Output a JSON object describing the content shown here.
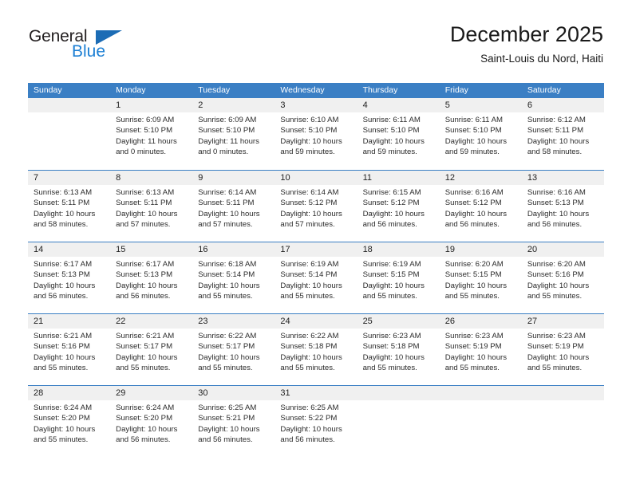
{
  "brand": {
    "name_part1": "General",
    "name_part2": "Blue",
    "triangle_icon": "triangle-icon",
    "accent_color": "#1c7fd4"
  },
  "header": {
    "title": "December 2025",
    "subtitle": "Saint-Louis du Nord, Haiti"
  },
  "calendar": {
    "header_bg": "#3b7fc4",
    "daynum_bg": "#f0f0f0",
    "weekdays": [
      "Sunday",
      "Monday",
      "Tuesday",
      "Wednesday",
      "Thursday",
      "Friday",
      "Saturday"
    ],
    "weeks": [
      [
        {
          "day": "",
          "sunrise": "",
          "sunset": "",
          "daylight_line1": "",
          "daylight_line2": "",
          "empty": true
        },
        {
          "day": "1",
          "sunrise": "Sunrise: 6:09 AM",
          "sunset": "Sunset: 5:10 PM",
          "daylight_line1": "Daylight: 11 hours",
          "daylight_line2": "and 0 minutes."
        },
        {
          "day": "2",
          "sunrise": "Sunrise: 6:09 AM",
          "sunset": "Sunset: 5:10 PM",
          "daylight_line1": "Daylight: 11 hours",
          "daylight_line2": "and 0 minutes."
        },
        {
          "day": "3",
          "sunrise": "Sunrise: 6:10 AM",
          "sunset": "Sunset: 5:10 PM",
          "daylight_line1": "Daylight: 10 hours",
          "daylight_line2": "and 59 minutes."
        },
        {
          "day": "4",
          "sunrise": "Sunrise: 6:11 AM",
          "sunset": "Sunset: 5:10 PM",
          "daylight_line1": "Daylight: 10 hours",
          "daylight_line2": "and 59 minutes."
        },
        {
          "day": "5",
          "sunrise": "Sunrise: 6:11 AM",
          "sunset": "Sunset: 5:10 PM",
          "daylight_line1": "Daylight: 10 hours",
          "daylight_line2": "and 59 minutes."
        },
        {
          "day": "6",
          "sunrise": "Sunrise: 6:12 AM",
          "sunset": "Sunset: 5:11 PM",
          "daylight_line1": "Daylight: 10 hours",
          "daylight_line2": "and 58 minutes."
        }
      ],
      [
        {
          "day": "7",
          "sunrise": "Sunrise: 6:13 AM",
          "sunset": "Sunset: 5:11 PM",
          "daylight_line1": "Daylight: 10 hours",
          "daylight_line2": "and 58 minutes."
        },
        {
          "day": "8",
          "sunrise": "Sunrise: 6:13 AM",
          "sunset": "Sunset: 5:11 PM",
          "daylight_line1": "Daylight: 10 hours",
          "daylight_line2": "and 57 minutes."
        },
        {
          "day": "9",
          "sunrise": "Sunrise: 6:14 AM",
          "sunset": "Sunset: 5:11 PM",
          "daylight_line1": "Daylight: 10 hours",
          "daylight_line2": "and 57 minutes."
        },
        {
          "day": "10",
          "sunrise": "Sunrise: 6:14 AM",
          "sunset": "Sunset: 5:12 PM",
          "daylight_line1": "Daylight: 10 hours",
          "daylight_line2": "and 57 minutes."
        },
        {
          "day": "11",
          "sunrise": "Sunrise: 6:15 AM",
          "sunset": "Sunset: 5:12 PM",
          "daylight_line1": "Daylight: 10 hours",
          "daylight_line2": "and 56 minutes."
        },
        {
          "day": "12",
          "sunrise": "Sunrise: 6:16 AM",
          "sunset": "Sunset: 5:12 PM",
          "daylight_line1": "Daylight: 10 hours",
          "daylight_line2": "and 56 minutes."
        },
        {
          "day": "13",
          "sunrise": "Sunrise: 6:16 AM",
          "sunset": "Sunset: 5:13 PM",
          "daylight_line1": "Daylight: 10 hours",
          "daylight_line2": "and 56 minutes."
        }
      ],
      [
        {
          "day": "14",
          "sunrise": "Sunrise: 6:17 AM",
          "sunset": "Sunset: 5:13 PM",
          "daylight_line1": "Daylight: 10 hours",
          "daylight_line2": "and 56 minutes."
        },
        {
          "day": "15",
          "sunrise": "Sunrise: 6:17 AM",
          "sunset": "Sunset: 5:13 PM",
          "daylight_line1": "Daylight: 10 hours",
          "daylight_line2": "and 56 minutes."
        },
        {
          "day": "16",
          "sunrise": "Sunrise: 6:18 AM",
          "sunset": "Sunset: 5:14 PM",
          "daylight_line1": "Daylight: 10 hours",
          "daylight_line2": "and 55 minutes."
        },
        {
          "day": "17",
          "sunrise": "Sunrise: 6:19 AM",
          "sunset": "Sunset: 5:14 PM",
          "daylight_line1": "Daylight: 10 hours",
          "daylight_line2": "and 55 minutes."
        },
        {
          "day": "18",
          "sunrise": "Sunrise: 6:19 AM",
          "sunset": "Sunset: 5:15 PM",
          "daylight_line1": "Daylight: 10 hours",
          "daylight_line2": "and 55 minutes."
        },
        {
          "day": "19",
          "sunrise": "Sunrise: 6:20 AM",
          "sunset": "Sunset: 5:15 PM",
          "daylight_line1": "Daylight: 10 hours",
          "daylight_line2": "and 55 minutes."
        },
        {
          "day": "20",
          "sunrise": "Sunrise: 6:20 AM",
          "sunset": "Sunset: 5:16 PM",
          "daylight_line1": "Daylight: 10 hours",
          "daylight_line2": "and 55 minutes."
        }
      ],
      [
        {
          "day": "21",
          "sunrise": "Sunrise: 6:21 AM",
          "sunset": "Sunset: 5:16 PM",
          "daylight_line1": "Daylight: 10 hours",
          "daylight_line2": "and 55 minutes."
        },
        {
          "day": "22",
          "sunrise": "Sunrise: 6:21 AM",
          "sunset": "Sunset: 5:17 PM",
          "daylight_line1": "Daylight: 10 hours",
          "daylight_line2": "and 55 minutes."
        },
        {
          "day": "23",
          "sunrise": "Sunrise: 6:22 AM",
          "sunset": "Sunset: 5:17 PM",
          "daylight_line1": "Daylight: 10 hours",
          "daylight_line2": "and 55 minutes."
        },
        {
          "day": "24",
          "sunrise": "Sunrise: 6:22 AM",
          "sunset": "Sunset: 5:18 PM",
          "daylight_line1": "Daylight: 10 hours",
          "daylight_line2": "and 55 minutes."
        },
        {
          "day": "25",
          "sunrise": "Sunrise: 6:23 AM",
          "sunset": "Sunset: 5:18 PM",
          "daylight_line1": "Daylight: 10 hours",
          "daylight_line2": "and 55 minutes."
        },
        {
          "day": "26",
          "sunrise": "Sunrise: 6:23 AM",
          "sunset": "Sunset: 5:19 PM",
          "daylight_line1": "Daylight: 10 hours",
          "daylight_line2": "and 55 minutes."
        },
        {
          "day": "27",
          "sunrise": "Sunrise: 6:23 AM",
          "sunset": "Sunset: 5:19 PM",
          "daylight_line1": "Daylight: 10 hours",
          "daylight_line2": "and 55 minutes."
        }
      ],
      [
        {
          "day": "28",
          "sunrise": "Sunrise: 6:24 AM",
          "sunset": "Sunset: 5:20 PM",
          "daylight_line1": "Daylight: 10 hours",
          "daylight_line2": "and 55 minutes."
        },
        {
          "day": "29",
          "sunrise": "Sunrise: 6:24 AM",
          "sunset": "Sunset: 5:20 PM",
          "daylight_line1": "Daylight: 10 hours",
          "daylight_line2": "and 56 minutes."
        },
        {
          "day": "30",
          "sunrise": "Sunrise: 6:25 AM",
          "sunset": "Sunset: 5:21 PM",
          "daylight_line1": "Daylight: 10 hours",
          "daylight_line2": "and 56 minutes."
        },
        {
          "day": "31",
          "sunrise": "Sunrise: 6:25 AM",
          "sunset": "Sunset: 5:22 PM",
          "daylight_line1": "Daylight: 10 hours",
          "daylight_line2": "and 56 minutes."
        },
        {
          "day": "",
          "sunrise": "",
          "sunset": "",
          "daylight_line1": "",
          "daylight_line2": "",
          "empty": true
        },
        {
          "day": "",
          "sunrise": "",
          "sunset": "",
          "daylight_line1": "",
          "daylight_line2": "",
          "empty": true
        },
        {
          "day": "",
          "sunrise": "",
          "sunset": "",
          "daylight_line1": "",
          "daylight_line2": "",
          "empty": true
        }
      ]
    ]
  }
}
